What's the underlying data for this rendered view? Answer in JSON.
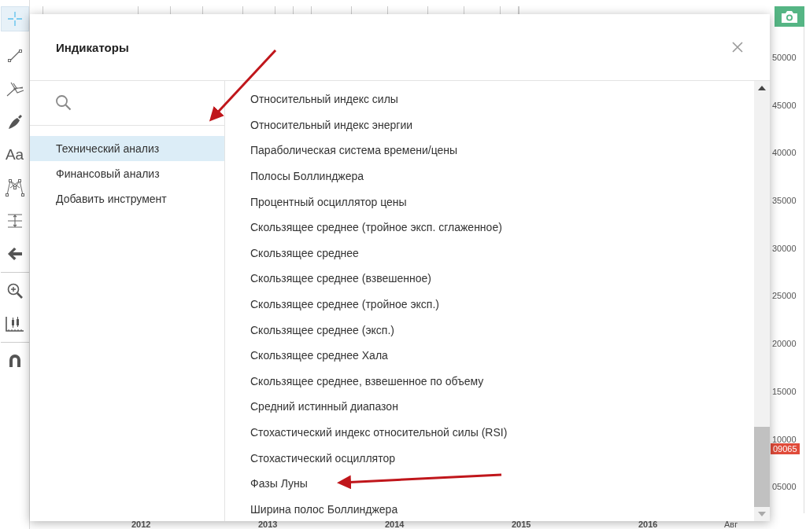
{
  "toolbar": [
    {
      "kind": "crosshair",
      "selected": true
    },
    {
      "kind": "line",
      "selected": false
    },
    {
      "kind": "pitchfork",
      "selected": false
    },
    {
      "kind": "brush",
      "selected": false
    },
    {
      "kind": "text",
      "label": "Aa",
      "selected": false
    },
    {
      "kind": "pattern",
      "selected": false
    },
    {
      "kind": "measure",
      "selected": false
    },
    {
      "kind": "back",
      "selected": false
    },
    {
      "kind": "separator"
    },
    {
      "kind": "zoom",
      "selected": false
    },
    {
      "kind": "ruler",
      "selected": false
    },
    {
      "kind": "separator"
    },
    {
      "kind": "magnet",
      "selected": false
    }
  ],
  "price_axis": [
    "50000",
    "45000",
    "40000",
    "35000",
    "30000",
    "25000",
    "20000",
    "15000",
    "10000",
    "05000"
  ],
  "price_marker": "09065",
  "time_axis": [
    "2012",
    "2013",
    "2014",
    "2015",
    "2016",
    "Авг"
  ],
  "dialog": {
    "title": "Индикаторы",
    "categories": [
      {
        "label": "Технический анализ",
        "selected": true
      },
      {
        "label": "Финансовый анализ",
        "selected": false
      },
      {
        "label": "Добавить инструмент",
        "selected": false
      }
    ],
    "indicators": [
      "Относительный индекс силы",
      "Относительный индекс энергии",
      "Параболическая система времени/цены",
      "Полосы Боллинджера",
      "Процентный осциллятор цены",
      "Скользящее среднее (тройное эксп. сглаженное)",
      "Скользящее среднее",
      "Скользящее среднее (взвешенное)",
      "Скользящее среднее (тройное эксп.)",
      "Скользящее среднее (эксп.)",
      "Скользящее среднее Хала",
      "Скользящее среднее, взвешенное по объему",
      "Средний истинный диапазон",
      "Стохастический индекс относительной силы (RSI)",
      "Стохастический осциллятор",
      "Фазы Луны",
      "Ширина полос Боллинджера"
    ]
  }
}
